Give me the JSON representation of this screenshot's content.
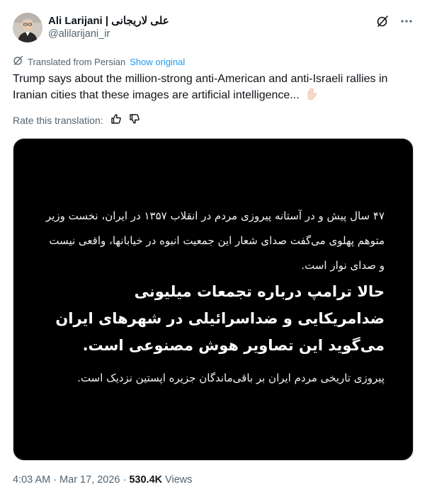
{
  "author": {
    "display_name": "Ali Larijani | علی لاریجانی",
    "handle": "@alilarijani_ir"
  },
  "translation": {
    "label": "Translated from Persian",
    "show_original": "Show original"
  },
  "tweet": {
    "text": "Trump says about the million-strong anti-American and anti-Israeli rallies in Iranian cities that these images are artificial intelligence..."
  },
  "rate": {
    "label": "Rate this translation:"
  },
  "media": {
    "paragraph1": "۴۷ سال پیش و در آستانه پیروزی مردم در انقلاب ۱۳۵۷ در ایران، نخست وزیر متوهم پهلوی می‌گفت صدای شعار این جمعیت انبوه در خیابانها، واقعی نیست و صدای نوار است.",
    "paragraph2": "حالا ترامپ درباره تجمعات میلیونی ضدامریکایی و ضداسرائیلی در شهرهای ایران می‌گوید این تصاویر هوش مصنوعی است.",
    "paragraph3": "پیروزی تاریخی مردم ایران بر باقی‌ماندگان جزیره اپستین نزدیک است."
  },
  "footer": {
    "time": "4:03 AM",
    "date": "Mar 17, 2026",
    "views_count": "530.4K",
    "views_label": "Views"
  },
  "icons": {
    "grok": "grok-icon",
    "more": "more-icon",
    "translate": "translate-icon",
    "thumbs_up": "thumbs-up-icon",
    "thumbs_down": "thumbs-down-icon",
    "emoji": "pointing-down-emoji"
  },
  "colors": {
    "link": "#1d9bf0",
    "secondary_text": "#536471",
    "media_background": "#000000"
  }
}
